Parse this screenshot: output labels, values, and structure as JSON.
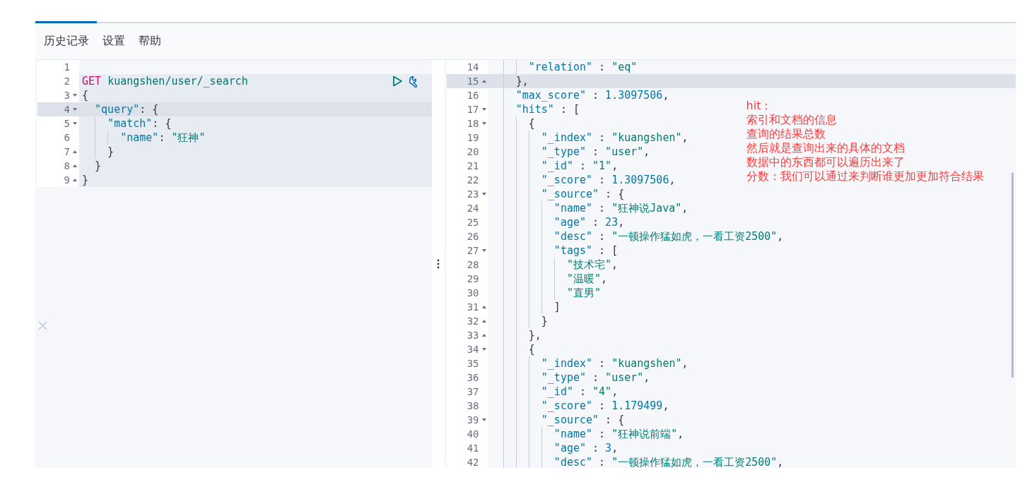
{
  "menu": [
    {
      "label": "历史记录"
    },
    {
      "label": "设置"
    },
    {
      "label": "帮助"
    }
  ],
  "request": {
    "lines": [
      {
        "num": "1",
        "fold_start": false,
        "fold_end": false,
        "highlighted": false,
        "active": false,
        "actions": false
      },
      {
        "num": "2",
        "fold_start": false,
        "fold_end": false,
        "highlighted": true,
        "active": false,
        "actions": true,
        "tokens": [
          {
            "kind": "method",
            "text": "GET "
          },
          {
            "kind": "path",
            "text": "kuangshen/user/_search"
          }
        ]
      },
      {
        "num": "3",
        "fold_start": true,
        "fold_end": false,
        "highlighted": true,
        "active": false,
        "actions": false,
        "tokens": [
          {
            "kind": "punct",
            "text": "{"
          }
        ]
      },
      {
        "num": "4",
        "fold_start": true,
        "fold_end": false,
        "highlighted": true,
        "active": true,
        "actions": false,
        "tokens": [
          {
            "kind": "key",
            "text": "  \"query\""
          },
          {
            "kind": "punct",
            "text": ": {"
          }
        ]
      },
      {
        "num": "5",
        "fold_start": true,
        "fold_end": false,
        "highlighted": true,
        "active": false,
        "actions": false,
        "tokens": [
          {
            "kind": "key",
            "text": "    \"match\""
          },
          {
            "kind": "punct",
            "text": ": {"
          }
        ]
      },
      {
        "num": "6",
        "fold_start": false,
        "fold_end": false,
        "highlighted": true,
        "active": false,
        "actions": false,
        "tokens": [
          {
            "kind": "key",
            "text": "      \"name\""
          },
          {
            "kind": "punct",
            "text": ": "
          },
          {
            "kind": "string",
            "text": "\"狂神\""
          }
        ]
      },
      {
        "num": "7",
        "fold_start": false,
        "fold_end": true,
        "highlighted": true,
        "active": false,
        "actions": false,
        "tokens": [
          {
            "kind": "punct",
            "text": "    }"
          }
        ]
      },
      {
        "num": "8",
        "fold_start": false,
        "fold_end": true,
        "highlighted": true,
        "active": false,
        "actions": false,
        "tokens": [
          {
            "kind": "punct",
            "text": "  }"
          }
        ]
      },
      {
        "num": "9",
        "fold_start": false,
        "fold_end": true,
        "highlighted": true,
        "active": false,
        "actions": false,
        "tokens": [
          {
            "kind": "punct",
            "text": "}"
          }
        ]
      }
    ]
  },
  "response": {
    "lines": [
      {
        "num": "14",
        "fold_start": false,
        "fold_end": false,
        "active": false,
        "tokens": [
          {
            "kind": "key",
            "text": "      \"relation\""
          },
          {
            "kind": "punct",
            "text": " : "
          },
          {
            "kind": "string",
            "text": "\"eq\""
          }
        ]
      },
      {
        "num": "15",
        "fold_start": false,
        "fold_end": true,
        "active": true,
        "tokens": [
          {
            "kind": "punct",
            "text": "    },"
          }
        ]
      },
      {
        "num": "16",
        "fold_start": false,
        "fold_end": false,
        "active": false,
        "tokens": [
          {
            "kind": "key",
            "text": "    \"max_score\""
          },
          {
            "kind": "punct",
            "text": " : "
          },
          {
            "kind": "number",
            "text": "1.3097506"
          },
          {
            "kind": "punct",
            "text": ","
          }
        ]
      },
      {
        "num": "17",
        "fold_start": true,
        "fold_end": false,
        "active": false,
        "tokens": [
          {
            "kind": "key",
            "text": "    \"hits\""
          },
          {
            "kind": "punct",
            "text": " : ["
          }
        ]
      },
      {
        "num": "18",
        "fold_start": true,
        "fold_end": false,
        "active": false,
        "tokens": [
          {
            "kind": "punct",
            "text": "      {"
          }
        ]
      },
      {
        "num": "19",
        "fold_start": false,
        "fold_end": false,
        "active": false,
        "tokens": [
          {
            "kind": "key",
            "text": "        \"_index\""
          },
          {
            "kind": "punct",
            "text": " : "
          },
          {
            "kind": "string",
            "text": "\"kuangshen\""
          },
          {
            "kind": "punct",
            "text": ","
          }
        ]
      },
      {
        "num": "20",
        "fold_start": false,
        "fold_end": false,
        "active": false,
        "tokens": [
          {
            "kind": "key",
            "text": "        \"_type\""
          },
          {
            "kind": "punct",
            "text": " : "
          },
          {
            "kind": "string",
            "text": "\"user\""
          },
          {
            "kind": "punct",
            "text": ","
          }
        ]
      },
      {
        "num": "21",
        "fold_start": false,
        "fold_end": false,
        "active": false,
        "tokens": [
          {
            "kind": "key",
            "text": "        \"_id\""
          },
          {
            "kind": "punct",
            "text": " : "
          },
          {
            "kind": "string",
            "text": "\"1\""
          },
          {
            "kind": "punct",
            "text": ","
          }
        ]
      },
      {
        "num": "22",
        "fold_start": false,
        "fold_end": false,
        "active": false,
        "tokens": [
          {
            "kind": "key",
            "text": "        \"_score\""
          },
          {
            "kind": "punct",
            "text": " : "
          },
          {
            "kind": "number",
            "text": "1.3097506"
          },
          {
            "kind": "punct",
            "text": ","
          }
        ]
      },
      {
        "num": "23",
        "fold_start": true,
        "fold_end": false,
        "active": false,
        "tokens": [
          {
            "kind": "key",
            "text": "        \"_source\""
          },
          {
            "kind": "punct",
            "text": " : {"
          }
        ]
      },
      {
        "num": "24",
        "fold_start": false,
        "fold_end": false,
        "active": false,
        "tokens": [
          {
            "kind": "key",
            "text": "          \"name\""
          },
          {
            "kind": "punct",
            "text": " : "
          },
          {
            "kind": "string",
            "text": "\"狂神说Java\""
          },
          {
            "kind": "punct",
            "text": ","
          }
        ]
      },
      {
        "num": "25",
        "fold_start": false,
        "fold_end": false,
        "active": false,
        "tokens": [
          {
            "kind": "key",
            "text": "          \"age\""
          },
          {
            "kind": "punct",
            "text": " : "
          },
          {
            "kind": "number",
            "text": "23"
          },
          {
            "kind": "punct",
            "text": ","
          }
        ]
      },
      {
        "num": "26",
        "fold_start": false,
        "fold_end": false,
        "active": false,
        "tokens": [
          {
            "kind": "key",
            "text": "          \"desc\""
          },
          {
            "kind": "punct",
            "text": " : "
          },
          {
            "kind": "string",
            "text": "\"一顿操作猛如虎，一看工资2500\""
          },
          {
            "kind": "punct",
            "text": ","
          }
        ]
      },
      {
        "num": "27",
        "fold_start": true,
        "fold_end": false,
        "active": false,
        "tokens": [
          {
            "kind": "key",
            "text": "          \"tags\""
          },
          {
            "kind": "punct",
            "text": " : ["
          }
        ]
      },
      {
        "num": "28",
        "fold_start": false,
        "fold_end": false,
        "active": false,
        "tokens": [
          {
            "kind": "string",
            "text": "            \"技术宅\""
          },
          {
            "kind": "punct",
            "text": ","
          }
        ]
      },
      {
        "num": "29",
        "fold_start": false,
        "fold_end": false,
        "active": false,
        "tokens": [
          {
            "kind": "string",
            "text": "            \"温暖\""
          },
          {
            "kind": "punct",
            "text": ","
          }
        ]
      },
      {
        "num": "30",
        "fold_start": false,
        "fold_end": false,
        "active": false,
        "tokens": [
          {
            "kind": "string",
            "text": "            \"直男\""
          }
        ]
      },
      {
        "num": "31",
        "fold_start": false,
        "fold_end": true,
        "active": false,
        "tokens": [
          {
            "kind": "punct",
            "text": "          ]"
          }
        ]
      },
      {
        "num": "32",
        "fold_start": false,
        "fold_end": true,
        "active": false,
        "tokens": [
          {
            "kind": "punct",
            "text": "        }"
          }
        ]
      },
      {
        "num": "33",
        "fold_start": false,
        "fold_end": true,
        "active": false,
        "tokens": [
          {
            "kind": "punct",
            "text": "      },"
          }
        ]
      },
      {
        "num": "34",
        "fold_start": true,
        "fold_end": false,
        "active": false,
        "tokens": [
          {
            "kind": "punct",
            "text": "      {"
          }
        ]
      },
      {
        "num": "35",
        "fold_start": false,
        "fold_end": false,
        "active": false,
        "tokens": [
          {
            "kind": "key",
            "text": "        \"_index\""
          },
          {
            "kind": "punct",
            "text": " : "
          },
          {
            "kind": "string",
            "text": "\"kuangshen\""
          },
          {
            "kind": "punct",
            "text": ","
          }
        ]
      },
      {
        "num": "36",
        "fold_start": false,
        "fold_end": false,
        "active": false,
        "tokens": [
          {
            "kind": "key",
            "text": "        \"_type\""
          },
          {
            "kind": "punct",
            "text": " : "
          },
          {
            "kind": "string",
            "text": "\"user\""
          },
          {
            "kind": "punct",
            "text": ","
          }
        ]
      },
      {
        "num": "37",
        "fold_start": false,
        "fold_end": false,
        "active": false,
        "tokens": [
          {
            "kind": "key",
            "text": "        \"_id\""
          },
          {
            "kind": "punct",
            "text": " : "
          },
          {
            "kind": "string",
            "text": "\"4\""
          },
          {
            "kind": "punct",
            "text": ","
          }
        ]
      },
      {
        "num": "38",
        "fold_start": false,
        "fold_end": false,
        "active": false,
        "tokens": [
          {
            "kind": "key",
            "text": "        \"_score\""
          },
          {
            "kind": "punct",
            "text": " : "
          },
          {
            "kind": "number",
            "text": "1.179499"
          },
          {
            "kind": "punct",
            "text": ","
          }
        ]
      },
      {
        "num": "39",
        "fold_start": true,
        "fold_end": false,
        "active": false,
        "tokens": [
          {
            "kind": "key",
            "text": "        \"_source\""
          },
          {
            "kind": "punct",
            "text": " : {"
          }
        ]
      },
      {
        "num": "40",
        "fold_start": false,
        "fold_end": false,
        "active": false,
        "tokens": [
          {
            "kind": "key",
            "text": "          \"name\""
          },
          {
            "kind": "punct",
            "text": " : "
          },
          {
            "kind": "string",
            "text": "\"狂神说前端\""
          },
          {
            "kind": "punct",
            "text": ","
          }
        ]
      },
      {
        "num": "41",
        "fold_start": false,
        "fold_end": false,
        "active": false,
        "tokens": [
          {
            "kind": "key",
            "text": "          \"age\""
          },
          {
            "kind": "punct",
            "text": " : "
          },
          {
            "kind": "number",
            "text": "3"
          },
          {
            "kind": "punct",
            "text": ","
          }
        ]
      },
      {
        "num": "42",
        "fold_start": false,
        "fold_end": false,
        "active": false,
        "tokens": [
          {
            "kind": "key",
            "text": "          \"desc\""
          },
          {
            "kind": "punct",
            "text": " : "
          },
          {
            "kind": "string",
            "text": "\"一顿操作猛如虎，一看工资2500\""
          },
          {
            "kind": "punct",
            "text": ","
          }
        ]
      }
    ]
  },
  "annotation": {
    "lines": [
      "hit：",
      "索引和文档的信息",
      "查询的结果总数",
      "然后就是查询出来的具体的文档",
      "数据中的东西都可以遍历出来了",
      "分数：我们可以通过来判断谁更加更加符合结果"
    ]
  }
}
